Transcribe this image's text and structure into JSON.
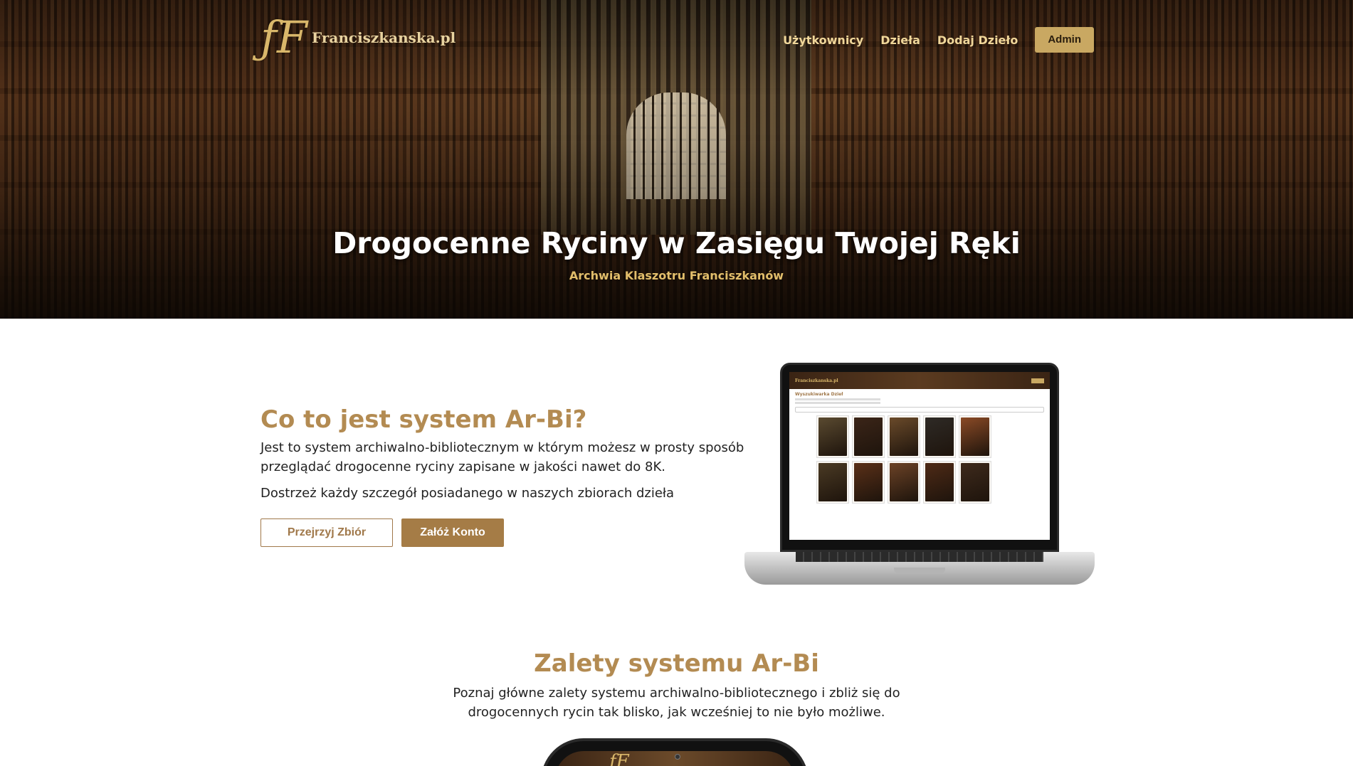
{
  "header": {
    "logo_mark": "ƒF",
    "logo_text": "Franciszkanska.pl",
    "nav": [
      "Użytkownicy",
      "Dzieła",
      "Dodaj Dzieło"
    ],
    "admin_label": "Admin"
  },
  "hero": {
    "title": "Drogocenne Ryciny w Zasięgu Twojej Ręki",
    "subtitle": "Archwia Klaszotru Franciszkanów"
  },
  "about": {
    "title": "Co to jest system Ar-Bi?",
    "paragraph1": "Jest to system archiwalno-bibliotecznym w którym możesz w prosty sposób przeglądać drogocenne ryciny zapisane w jakości nawet do 8K.",
    "paragraph2": "Dostrzeż każdy szczegół posiadanego w naszych zbiorach dzieła",
    "browse_label": "Przejrzyj Zbiór",
    "register_label": "Załóż Konto"
  },
  "laptop_preview": {
    "logo_text": "Franciszkanska.pl",
    "title": "Wyszukiwarka Dzieł",
    "book_colors": [
      "#5a4a30",
      "#3b2518",
      "#6a4a2a",
      "#2e2a26",
      "#8a4a26",
      "#4a3a24",
      "#5a3018",
      "#6b4226",
      "#4e2a16",
      "#3e2a1c"
    ]
  },
  "advantages": {
    "title": "Zalety systemu Ar-Bi",
    "description": "Poznaj główne zalety systemu archiwalno-bibliotecznego i zbliż się do drogocennych rycin tak blisko, jak wcześniej to nie było możliwe."
  },
  "colors": {
    "accent": "#b38b52",
    "button": "#a57c46",
    "admin": "#c9a862",
    "nav_text": "#f0d79a"
  }
}
